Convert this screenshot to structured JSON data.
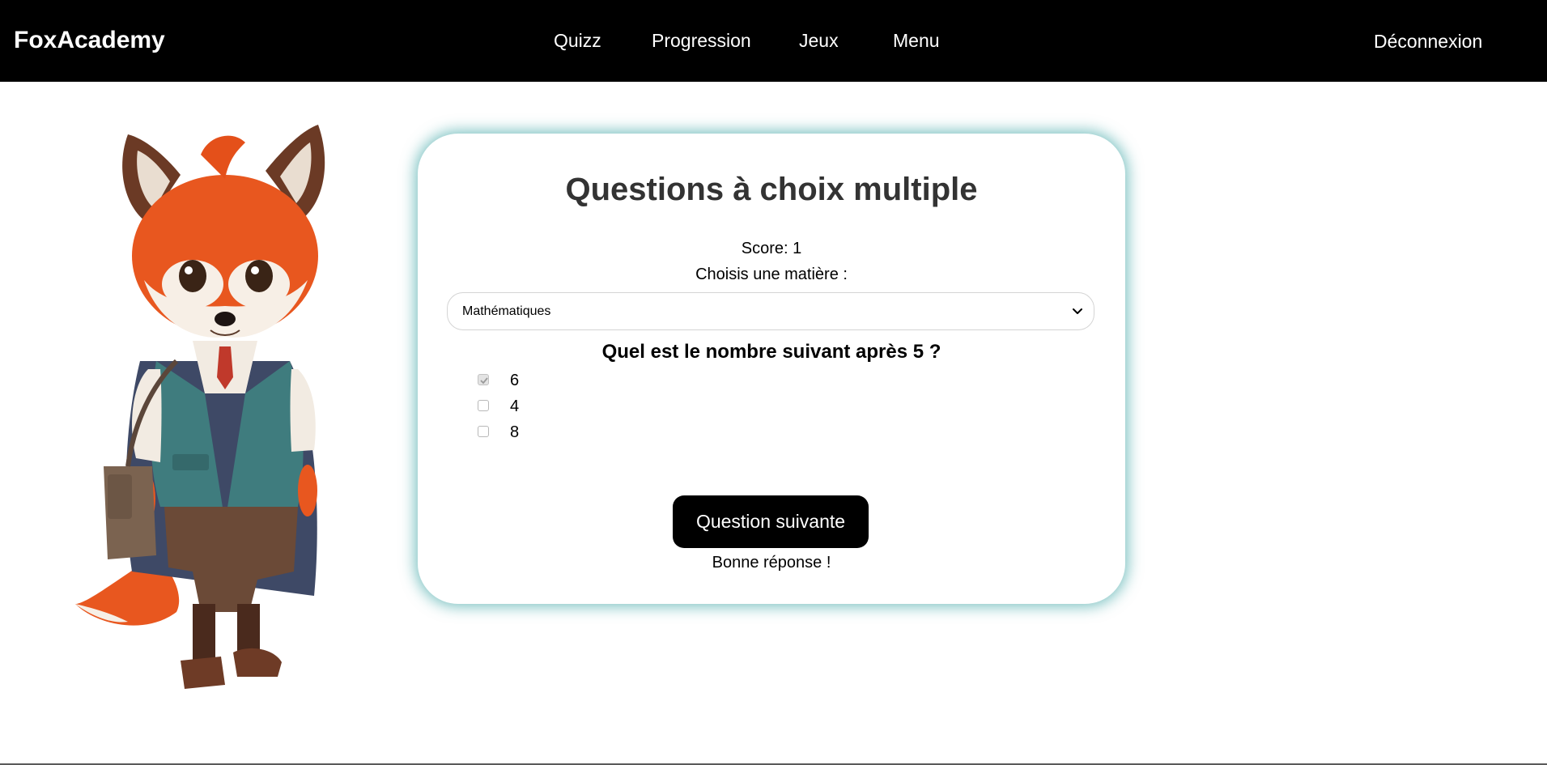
{
  "navbar": {
    "brand": "FoxAcademy",
    "links": [
      "Quizz",
      "Progression",
      "Jeux",
      "Menu"
    ],
    "logout": "Déconnexion"
  },
  "quiz": {
    "title": "Questions à choix multiple",
    "score": "Score: 1",
    "subject_label": "Choisis une matière :",
    "subject_selected": "Mathématiques",
    "question": "Quel est le nombre suivant après 5 ?",
    "options": [
      {
        "label": "6",
        "checked": true
      },
      {
        "label": "4",
        "checked": false
      },
      {
        "label": "8",
        "checked": false
      }
    ],
    "next_button": "Question suivante",
    "feedback": "Bonne réponse !"
  },
  "colors": {
    "navbar_bg": "#000000",
    "card_glow": "#48aaaa",
    "title": "#333333",
    "fox_orange": "#e8571f"
  },
  "icons": [
    "chevron-down-icon",
    "checkmark-icon",
    "fox-mascot"
  ]
}
